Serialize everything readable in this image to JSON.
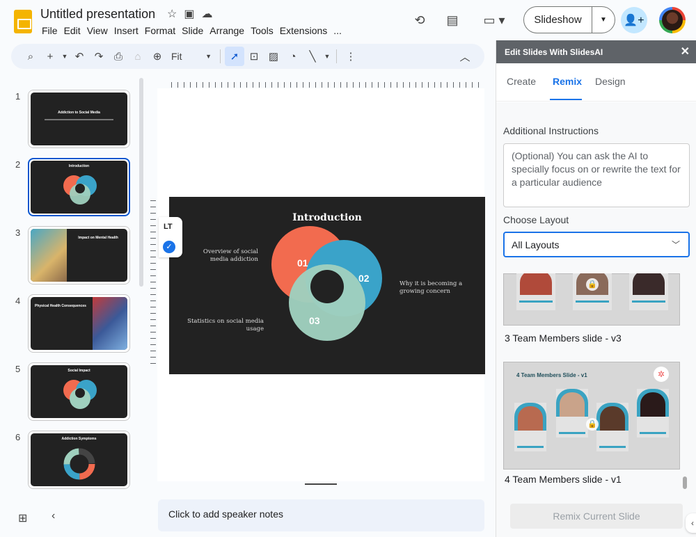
{
  "document": {
    "title": "Untitled presentation"
  },
  "menu": [
    "File",
    "Edit",
    "View",
    "Insert",
    "Format",
    "Slide",
    "Arrange",
    "Tools",
    "Extensions",
    "..."
  ],
  "header": {
    "slideshow_label": "Slideshow"
  },
  "toolbar": {
    "zoom_label": "Fit"
  },
  "filmstrip": {
    "slides": [
      {
        "number": "1",
        "title": "Addiction to Social Media"
      },
      {
        "number": "2",
        "title": "Introduction"
      },
      {
        "number": "3",
        "title": "Impact on Mental Health"
      },
      {
        "number": "4",
        "title": "Physical Health Consequences"
      },
      {
        "number": "5",
        "title": "Social Impact"
      },
      {
        "number": "6",
        "title": "Addiction Symptoms"
      }
    ]
  },
  "slide": {
    "title": "Introduction",
    "left_top": "Overview of social media addiction",
    "left_bottom": "Statistics on social media usage",
    "right": "Why it is becoming a growing concern",
    "ring_labels": [
      "01",
      "02",
      "03"
    ],
    "ring_colors": [
      "#f26b4f",
      "#3aa3c9",
      "#9fd0be"
    ]
  },
  "notes": {
    "placeholder": "Click to add speaker notes"
  },
  "panel": {
    "title": "Edit Slides With SlidesAI",
    "tabs": [
      "Create",
      "Remix",
      "Design"
    ],
    "active_tab": "Remix",
    "instructions_label": "Additional Instructions",
    "instructions_placeholder": "(Optional) You can ask the AI to specially focus on or rewrite the text for a particular audience",
    "layout_label": "Choose Layout",
    "layout_value": "All Layouts",
    "layouts": [
      {
        "caption": "3 Team Members slide - v3"
      },
      {
        "caption": "4 Team Members slide - v1",
        "heading": "4 Team Members Slide - v1"
      }
    ],
    "remix_button": "Remix Current Slide"
  }
}
